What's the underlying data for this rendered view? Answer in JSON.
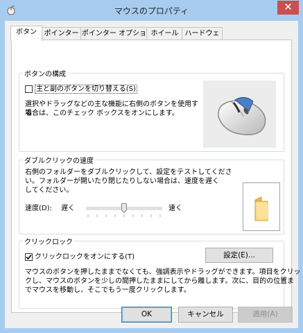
{
  "window": {
    "title": "マウスのプロパティ",
    "close_glyph": "✕"
  },
  "tabs": [
    {
      "label": "ボタン",
      "active": true
    },
    {
      "label": "ポインター",
      "active": false
    },
    {
      "label": "ポインター オプション",
      "active": false
    },
    {
      "label": "ホイール",
      "active": false
    },
    {
      "label": "ハードウェア",
      "active": false
    }
  ],
  "button_config": {
    "group_label": "ボタンの構成",
    "swap_checkbox_label": "主と副のボタンを切り替える(S)",
    "swap_checked": false,
    "description_line1": "選択やドラッグなどの主な機能に右側のボタンを使用する",
    "description_line2": "場合は、このチェック ボックスをオンにします。",
    "image_icon": "mouse-icon"
  },
  "double_click": {
    "group_label": "ダブルクリックの速度",
    "description_line1": "右側のフォルダーをダブルクリックして、設定をテストしてくださ",
    "description_line2": "い。フォルダーが開いたり閉じたりしない場合は、速度を遅く",
    "description_line3": "してください。",
    "speed_label": "速度(D):",
    "slow_label": "遅く",
    "fast_label": "速く",
    "slider_value": 0.5,
    "folder_icon": "folder-icon"
  },
  "click_lock": {
    "group_label": "クリックロック",
    "checkbox_label": "クリックロックをオンにする(T)",
    "checked": true,
    "settings_button": "設定(E)...",
    "description_line1": "マウスのボタンを押したままでなくても、強調表示やドラッグができます。項目をクリッ",
    "description_line2": "クし、マウスのボタンを少しの間押したままにしてから離します。次に、目的の位置ま",
    "description_line3": "でマウスを移動し、そこでもう一度クリックします。"
  },
  "footer": {
    "ok": "OK",
    "cancel": "キャンセル",
    "apply": "適用(A)"
  },
  "colors": {
    "title_bar": "#a8ccf0",
    "close_button": "#c75050",
    "default_button_border": "#3c7fb1"
  }
}
